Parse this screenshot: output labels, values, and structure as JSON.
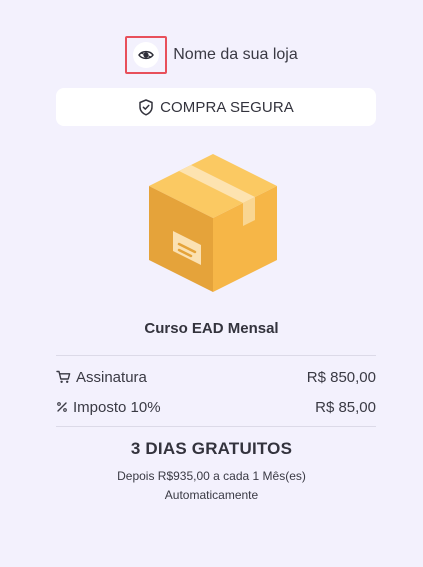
{
  "store": {
    "name": "Nome da sua loja",
    "logo_icon": "eye-icon"
  },
  "secure_badge": {
    "label": "COMPRA SEGURA",
    "icon": "shield-check-icon"
  },
  "product": {
    "image_icon": "package-box-icon",
    "title": "Curso EAD Mensal"
  },
  "summary": {
    "rows": [
      {
        "icon": "cart-icon",
        "label": "Assinatura",
        "value": "R$ 850,00"
      },
      {
        "icon": "percent-icon",
        "label": "Imposto 10%",
        "value": "R$ 85,00"
      }
    ]
  },
  "trial": {
    "title": "3 DIAS GRATUITOS",
    "recurrence_line1": "Depois R$935,00 a cada 1 Mês(es)",
    "recurrence_line2": "Automaticamente"
  },
  "colors": {
    "background": "#f3f1fd",
    "highlight_border": "#e8505b",
    "box_orange": "#f6b647",
    "box_tape": "#fde3b0"
  }
}
